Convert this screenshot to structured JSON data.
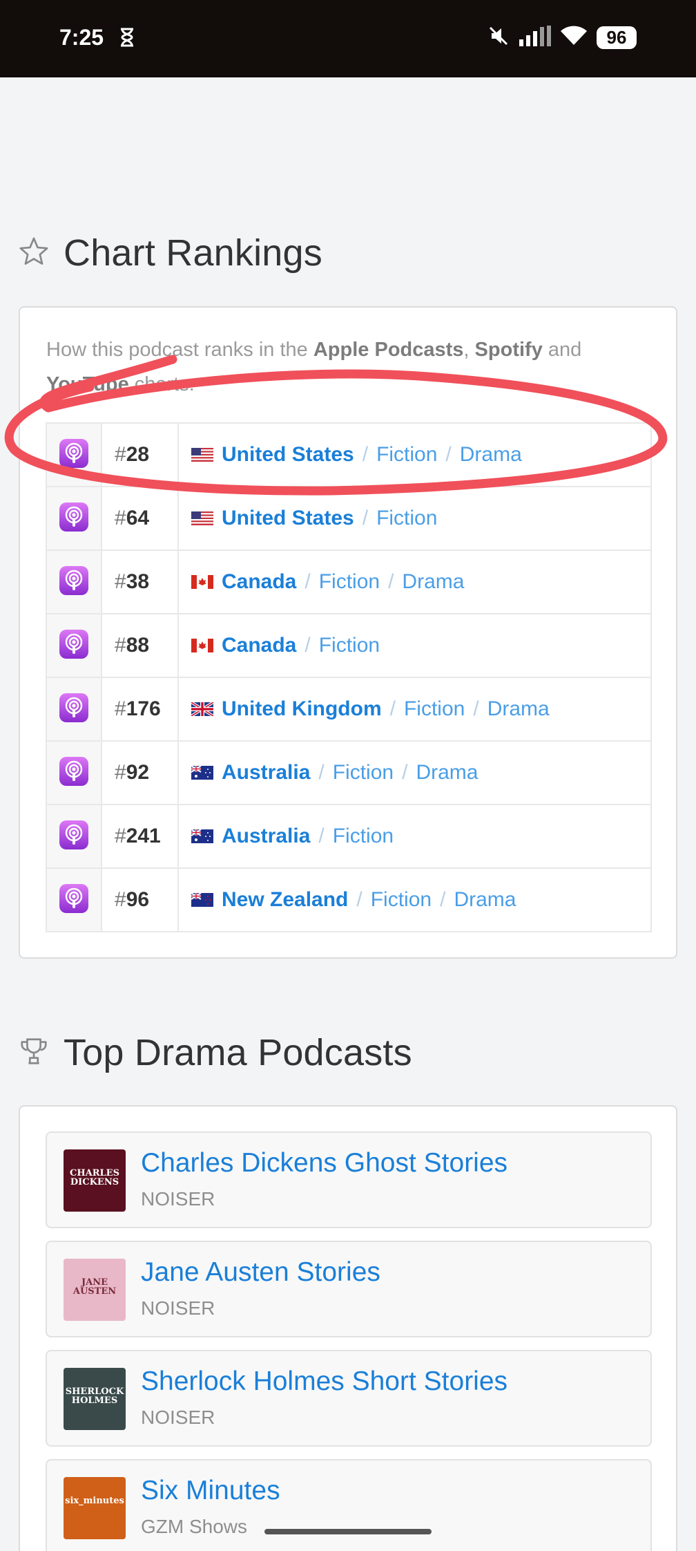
{
  "status_bar": {
    "time": "7:25",
    "battery": "96"
  },
  "chart_rankings": {
    "title": "Chart Rankings",
    "intro_prefix": "How this podcast ranks in the ",
    "intro_apple": "Apple Podcasts",
    "intro_comma": ", ",
    "intro_spotify": "Spotify",
    "intro_and": " and ",
    "intro_youtube": "YouTube",
    "intro_suffix": " charts.",
    "hash": "#",
    "rows": [
      {
        "rank": "28",
        "country": "United States",
        "flag": "us",
        "categories": [
          "Fiction",
          "Drama"
        ]
      },
      {
        "rank": "64",
        "country": "United States",
        "flag": "us",
        "categories": [
          "Fiction"
        ]
      },
      {
        "rank": "38",
        "country": "Canada",
        "flag": "ca",
        "categories": [
          "Fiction",
          "Drama"
        ]
      },
      {
        "rank": "88",
        "country": "Canada",
        "flag": "ca",
        "categories": [
          "Fiction"
        ]
      },
      {
        "rank": "176",
        "country": "United Kingdom",
        "flag": "gb",
        "categories": [
          "Fiction",
          "Drama"
        ]
      },
      {
        "rank": "92",
        "country": "Australia",
        "flag": "au",
        "categories": [
          "Fiction",
          "Drama"
        ]
      },
      {
        "rank": "241",
        "country": "Australia",
        "flag": "au",
        "categories": [
          "Fiction"
        ]
      },
      {
        "rank": "96",
        "country": "New Zealand",
        "flag": "nz",
        "categories": [
          "Fiction",
          "Drama"
        ]
      }
    ],
    "separator": "/"
  },
  "top_drama": {
    "title": "Top Drama Podcasts",
    "items": [
      {
        "title": "Charles Dickens Ghost Stories",
        "publisher": "NOISER",
        "thumb_text": "CHARLES DICKENS",
        "thumb_color": "#5a1020"
      },
      {
        "title": "Jane Austen Stories",
        "publisher": "NOISER",
        "thumb_text": "JANE AUSTEN",
        "thumb_color": "#e8b8c8"
      },
      {
        "title": "Sherlock Holmes Short Stories",
        "publisher": "NOISER",
        "thumb_text": "SHERLOCK HOLMES",
        "thumb_color": "#3a4a4a"
      },
      {
        "title": "Six Minutes",
        "publisher": "GZM Shows",
        "thumb_text": "six_minutes",
        "thumb_color": "#d06018"
      }
    ]
  },
  "colors": {
    "link": "#1a7fd8",
    "annotation": "#f0505a",
    "apple_podcasts": "#b14be6"
  }
}
